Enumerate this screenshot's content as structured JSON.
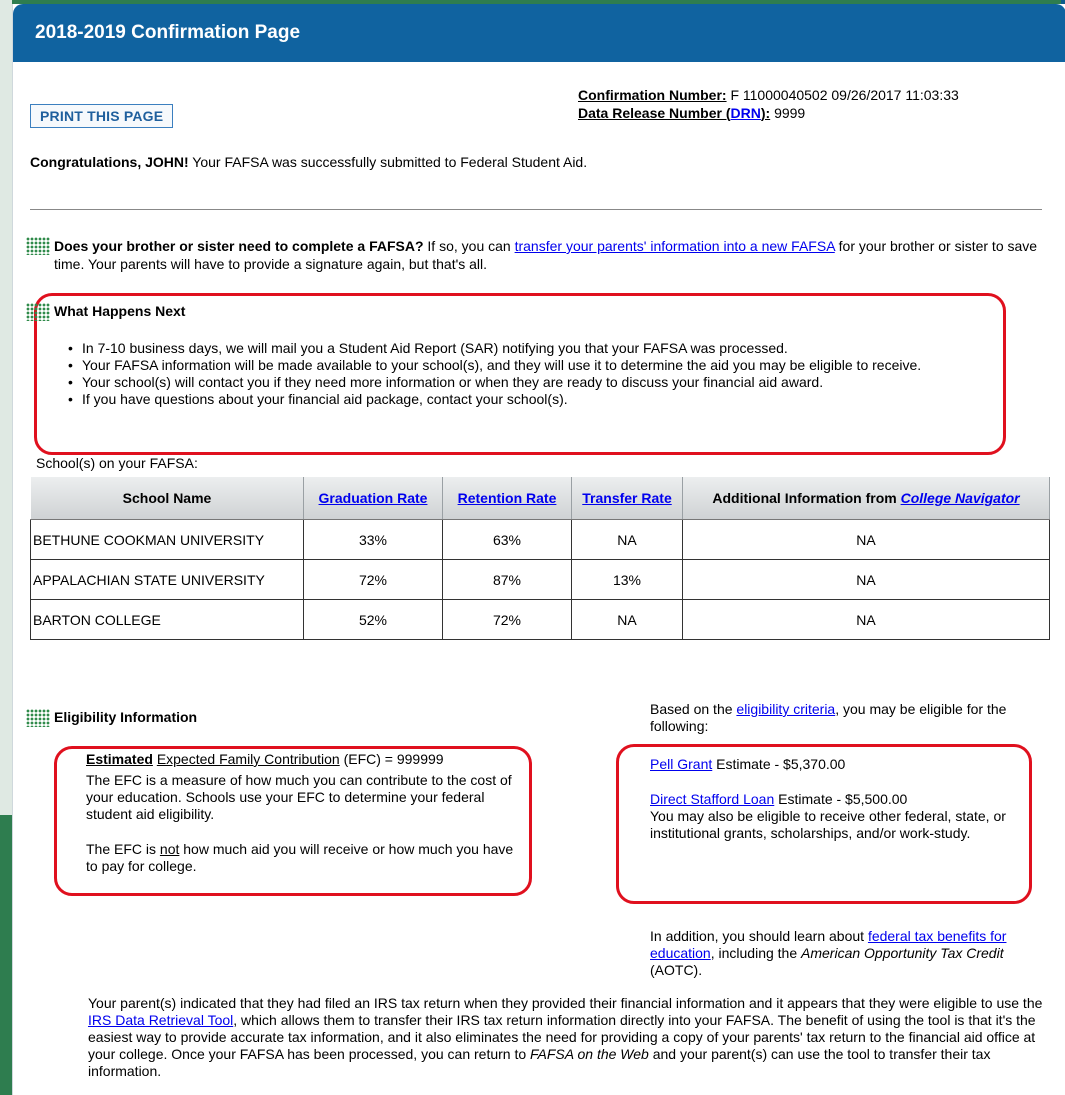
{
  "page": {
    "title": "2018-2019 Confirmation Page",
    "print_button": "PRINT THIS PAGE"
  },
  "confirmation": {
    "number_label": "Confirmation Number:",
    "number_value": "F 11000040502 09/26/2017 11:03:33",
    "drn_label_prefix": "Data Release Number (",
    "drn_link": "DRN",
    "drn_label_suffix": "):",
    "drn_value": "9999"
  },
  "congrats": {
    "bold": "Congratulations, JOHN!",
    "text": " Your FAFSA was successfully submitted to Federal Student Aid."
  },
  "sibling": {
    "bold": "Does your brother or sister need to complete a FAFSA?",
    "text1": " If so, you can ",
    "link": "transfer your parents' information into a new FAFSA",
    "text2": " for your brother or sister to save time. Your parents will have to provide a signature again, but that's all."
  },
  "what_happens_next": {
    "title": "What Happens Next",
    "items": [
      "In 7-10 business days, we will mail you a Student Aid Report (SAR) notifying you that your FAFSA was processed.",
      "Your FAFSA information will be made available to your school(s), and they will use it to determine the aid you may be eligible to receive.",
      "Your school(s) will contact you if they need more information or when they are ready to discuss your financial aid award.",
      "If you have questions about your financial aid package, contact your school(s)."
    ]
  },
  "schools": {
    "caption": "School(s) on your FAFSA:",
    "headers": {
      "name": "School Name",
      "graduation": "Graduation Rate",
      "retention": "Retention Rate",
      "transfer": "Transfer Rate",
      "additional_prefix": "Additional Information from ",
      "additional_link": "College Navigator"
    },
    "rows": [
      {
        "name": "BETHUNE COOKMAN UNIVERSITY",
        "graduation": "33%",
        "retention": "63%",
        "transfer": "NA",
        "additional": "NA"
      },
      {
        "name": "APPALACHIAN STATE UNIVERSITY",
        "graduation": "72%",
        "retention": "87%",
        "transfer": "13%",
        "additional": "NA"
      },
      {
        "name": "BARTON COLLEGE",
        "graduation": "52%",
        "retention": "72%",
        "transfer": "NA",
        "additional": "NA"
      }
    ]
  },
  "eligibility": {
    "title": "Eligibility Information",
    "efc_bold": "Estimated",
    "efc_link_text": "Expected Family Contribution",
    "efc_rest": " (EFC) = 999999",
    "efc_desc": "The EFC is a measure of how much you can contribute to the cost of your education. Schools use your EFC to determine your federal student aid eligibility.",
    "efc_not_prefix": "The EFC is ",
    "efc_not_word": "not",
    "efc_not_suffix": " how much aid you will receive or how much you have to pay for college.",
    "intro_prefix": "Based on the ",
    "intro_link": "eligibility criteria",
    "intro_suffix": ", you may be eligible for the following:",
    "pell_link": "Pell Grant",
    "pell_text": " Estimate - $5,370.00",
    "stafford_link": "Direct Stafford Loan",
    "stafford_text": " Estimate - $5,500.00",
    "other_aid": "You may also be eligible to receive other federal, state, or institutional grants, scholarships, and/or work-study.",
    "addition_prefix": "In addition, you should learn about ",
    "addition_link": "federal tax benefits for education",
    "addition_mid": ", including the ",
    "addition_italic": "American Opportunity Tax Credit",
    "addition_suffix": " (AOTC)."
  },
  "parents": {
    "text1": "Your parent(s) indicated that they had filed an IRS tax return when they provided their financial information and it appears that they were eligible to use the ",
    "link": "IRS Data Retrieval Tool",
    "text2": ", which allows them to transfer their IRS tax return information directly into your FAFSA. The benefit of using the tool is that it's the easiest way to provide accurate tax information, and it also eliminates the need for providing a copy of your parents' tax return to the financial aid office at your college. Once your FAFSA has been processed, you can return to ",
    "italic": "FAFSA on the Web",
    "text3": " and your parent(s) can use the tool to transfer their tax information."
  },
  "colors": {
    "header_blue": "#1063a0",
    "highlight_red": "#e0101e",
    "link_blue": "#0000ee",
    "icon_green": "#2f8a4a"
  }
}
